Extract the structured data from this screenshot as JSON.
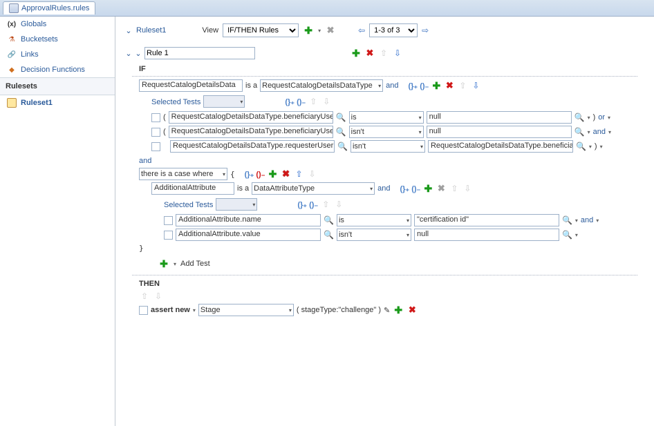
{
  "tab": {
    "title": "ApprovalRules.rules"
  },
  "sidebar": {
    "items": [
      {
        "label": "Globals",
        "icon": "(x)"
      },
      {
        "label": "Bucketsets",
        "icon": "bucket"
      },
      {
        "label": "Links",
        "icon": "link"
      },
      {
        "label": "Decision Functions",
        "icon": "df"
      }
    ],
    "rulesets_header": "Rulesets",
    "rulesets": [
      {
        "label": "Ruleset1"
      }
    ]
  },
  "toolbar": {
    "ruleset_label": "Ruleset1",
    "view_label": "View",
    "view_options": [
      "IF/THEN Rules"
    ],
    "pager": "1-3 of 3"
  },
  "rule": {
    "name": "Rule 1",
    "if_label": "IF",
    "then_label": "THEN",
    "isa": {
      "left": "RequestCatalogDetailsData",
      "mid": "is a",
      "right": "RequestCatalogDetailsDataType",
      "and": "and"
    },
    "selected_tests_label": "Selected Tests",
    "tests": [
      {
        "paren": "(",
        "lhs": "RequestCatalogDetailsDataType.beneficiaryUserDat",
        "op": "is",
        "rhs": "null",
        "close": ")",
        "conj": "or"
      },
      {
        "paren": "(",
        "lhs": "RequestCatalogDetailsDataType.beneficiaryUserDat",
        "op": "isn't",
        "rhs": "null",
        "close": "",
        "conj": "and"
      },
      {
        "paren": "",
        "lhs": "RequestCatalogDetailsDataType.requesterUserData",
        "op": "isn't",
        "rhs": "RequestCatalogDetailsDataType.beneficiaryUserDat",
        "close": ")",
        "conj": ""
      }
    ],
    "and_label": "and",
    "pattern": {
      "prefix": "there is a case where",
      "open_brace": "{",
      "isa_left": "AdditionalAttribute",
      "isa_mid": "is a",
      "isa_right": "DataAttributeType",
      "and": "and",
      "selected_tests_label": "Selected Tests",
      "tests": [
        {
          "lhs": "AdditionalAttribute.name",
          "op": "is",
          "rhs": "\"certification id\"",
          "conj": "and"
        },
        {
          "lhs": "AdditionalAttribute.value",
          "op": "isn't",
          "rhs": "null",
          "conj": ""
        }
      ],
      "close_brace": "}"
    },
    "add_test_label": "Add Test",
    "then": {
      "action": "assert new",
      "target": "Stage",
      "param": "( stageType:\"challenge\" )"
    }
  }
}
